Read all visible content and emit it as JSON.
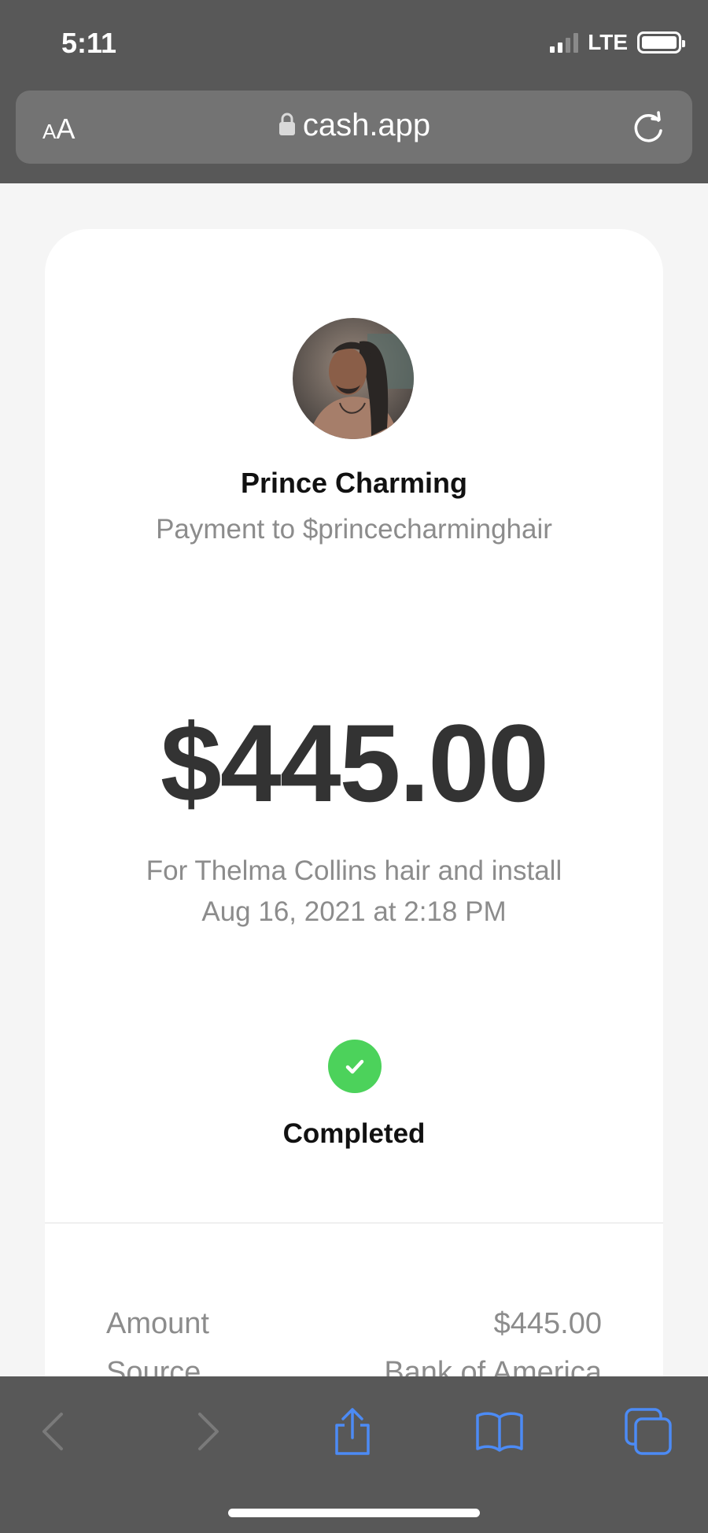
{
  "status_bar": {
    "time": "5:11",
    "network": "LTE"
  },
  "browser": {
    "text_size_label_small": "A",
    "text_size_label_big": "A",
    "url": "cash.app"
  },
  "payment": {
    "recipient_name": "Prince Charming",
    "payment_to": "Payment to $princecharminghair",
    "amount": "$445.00",
    "note": "For Thelma Collins hair and install",
    "datetime": "Aug 16, 2021 at 2:18 PM",
    "status": "Completed"
  },
  "details": [
    {
      "label": "Amount",
      "value": "$445.00"
    },
    {
      "label": "Source",
      "value": "Bank of America"
    }
  ],
  "colors": {
    "chrome": "#585858",
    "success": "#4cd25b",
    "toolbar_accent": "#4c8bf5",
    "toolbar_disabled": "#7a7a7a"
  },
  "icons": {
    "lock": "lock-icon",
    "reload": "reload-icon",
    "back": "chevron-left-icon",
    "forward": "chevron-right-icon",
    "share": "share-icon",
    "bookmarks": "book-icon",
    "tabs": "tabs-icon",
    "status": "checkmark-icon"
  }
}
